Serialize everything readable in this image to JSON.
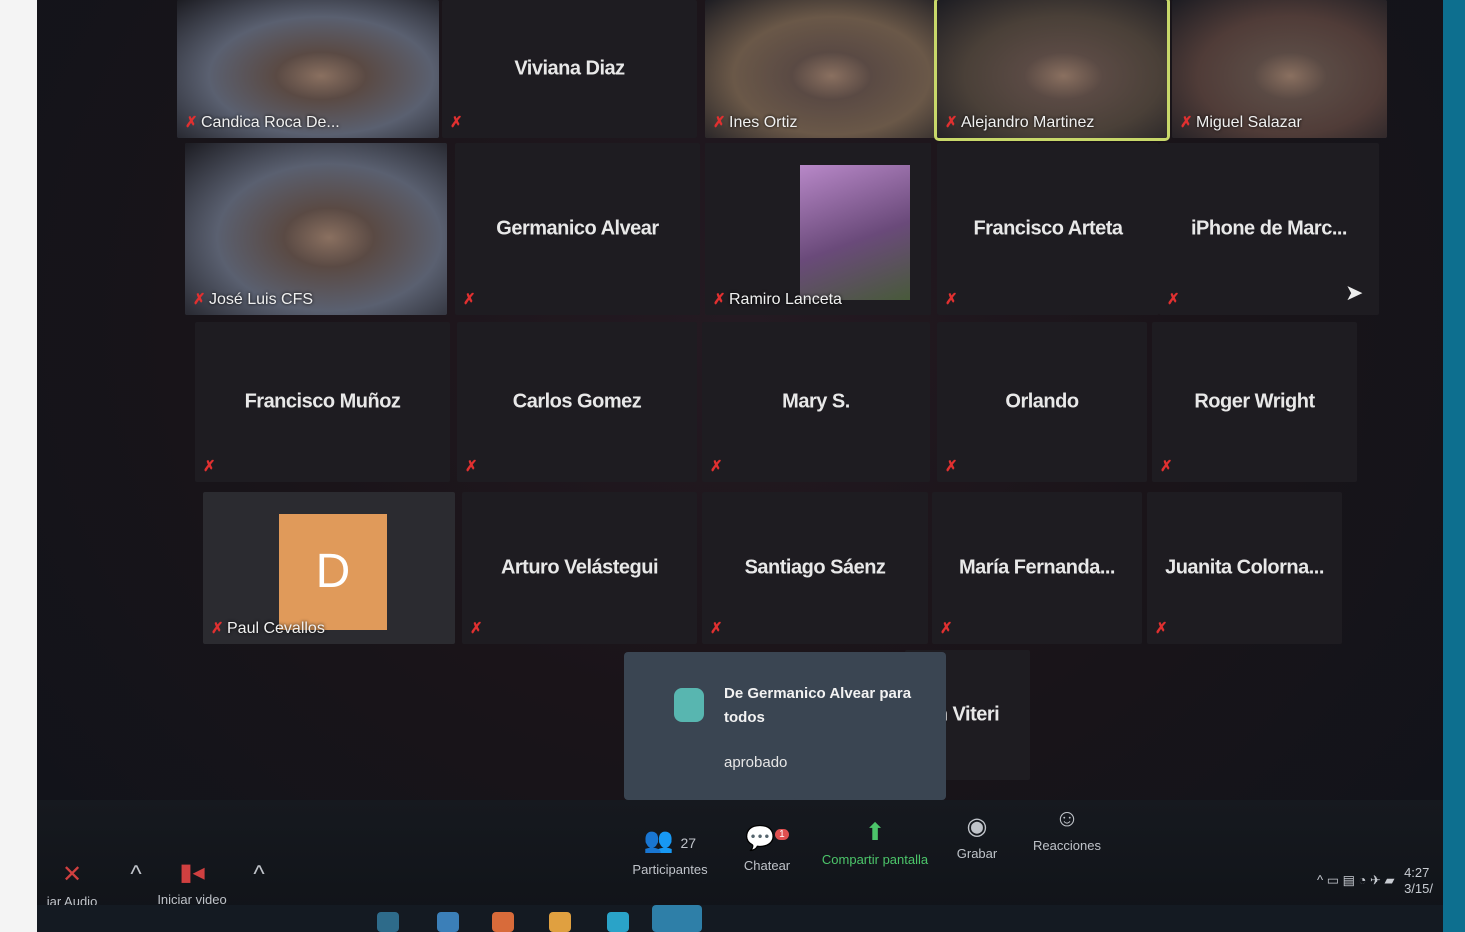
{
  "participants": [
    {
      "name": "Candica Roca De...",
      "type": "video",
      "row": 0,
      "col": 0
    },
    {
      "name": "Viviana Diaz",
      "type": "name",
      "row": 0,
      "col": 1
    },
    {
      "name": "Ines Ortiz",
      "type": "video",
      "row": 0,
      "col": 2
    },
    {
      "name": "Alejandro Martinez",
      "type": "video",
      "row": 0,
      "col": 3,
      "active": true
    },
    {
      "name": "Miguel Salazar",
      "type": "video",
      "row": 0,
      "col": 4
    },
    {
      "name": "José Luis CFS",
      "type": "video",
      "row": 1,
      "col": 0
    },
    {
      "name": "Germanico Alvear",
      "type": "name",
      "row": 1,
      "col": 1
    },
    {
      "name": "Ramiro Lanceta",
      "type": "photo",
      "row": 1,
      "col": 2
    },
    {
      "name": "Francisco Arteta",
      "type": "name",
      "row": 1,
      "col": 3
    },
    {
      "name": "iPhone de Marc...",
      "type": "name",
      "row": 1,
      "col": 4
    },
    {
      "name": "Francisco Muñoz",
      "type": "name",
      "row": 2,
      "col": 0
    },
    {
      "name": "Carlos Gomez",
      "type": "name",
      "row": 2,
      "col": 1
    },
    {
      "name": "Mary S.",
      "type": "name",
      "row": 2,
      "col": 2
    },
    {
      "name": "Orlando",
      "type": "name",
      "row": 2,
      "col": 3
    },
    {
      "name": "Roger Wright",
      "type": "name",
      "row": 2,
      "col": 4
    },
    {
      "name": "Paul Cevallos",
      "type": "avatar",
      "initial": "D",
      "row": 3,
      "col": 0
    },
    {
      "name": "Arturo Velástegui",
      "type": "name",
      "row": 3,
      "col": 1
    },
    {
      "name": "Santiago Sáenz",
      "type": "name",
      "row": 3,
      "col": 2
    },
    {
      "name": "María Fernanda...",
      "type": "name",
      "row": 3,
      "col": 3
    },
    {
      "name": "Juanita Colorna...",
      "type": "name",
      "row": 3,
      "col": 4
    },
    {
      "name": "n Viteri",
      "type": "name",
      "row": 4,
      "col": 2
    }
  ],
  "chat_popup": {
    "title": "De Germanico Alvear para todos",
    "message": "aprobado"
  },
  "toolbar": {
    "audio_label": "iar Audio",
    "video_label": "Iniciar video",
    "participants_label": "Participantes",
    "participants_count": "27",
    "chat_label": "Chatear",
    "chat_badge": "1",
    "share_label": "Compartir pantalla",
    "record_label": "Grabar",
    "reactions_label": "Reacciones"
  },
  "tray": {
    "time": "4:27",
    "date": "3/15/"
  },
  "colors": {
    "active_border": "#c8d86a",
    "mute": "#e03030",
    "avatar": "#e09a5a",
    "frame_right": "#0d6f8f"
  }
}
